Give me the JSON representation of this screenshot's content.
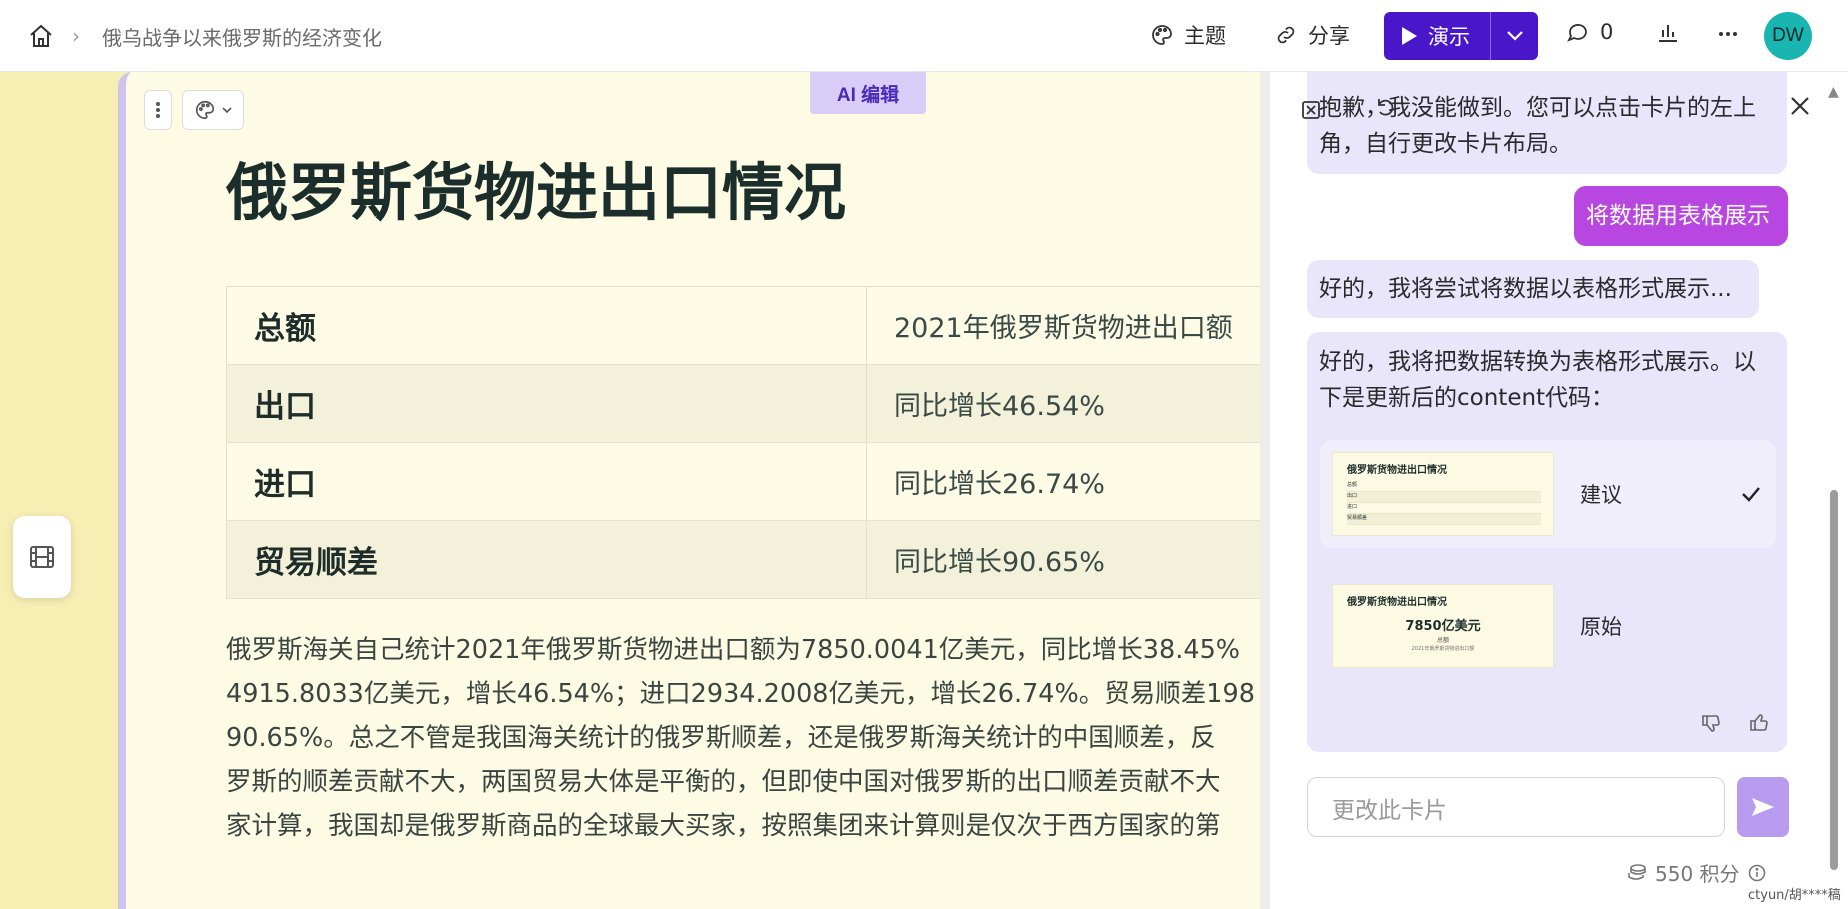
{
  "header": {
    "doc_title": "俄乌战争以来俄罗斯的经济变化",
    "theme_label": "主题",
    "share_label": "分享",
    "present_label": "演示",
    "comments_count": "0",
    "avatar_initials": "DW"
  },
  "card": {
    "ai_edit_label": "AI 编辑",
    "title": "俄罗斯货物进出口情况",
    "table": [
      {
        "key": "总额",
        "value": "2021年俄罗斯货物进出口额"
      },
      {
        "key": "出口",
        "value": "同比增长46.54%"
      },
      {
        "key": "进口",
        "value": "同比增长26.74%"
      },
      {
        "key": "贸易顺差",
        "value": "同比增长90.65%"
      }
    ],
    "paragraph_lines": [
      "俄罗斯海关自己统计2021年俄罗斯货物进出口额为7850.0041亿美元，同比增长38.45%",
      "4915.8033亿美元，增长46.54%；进口2934.2008亿美元，增长26.74%。贸易顺差198",
      "90.65%。总之不管是我国海关统计的俄罗斯顺差，还是俄罗斯海关统计的中国顺差，反",
      "罗斯的顺差贡献不大，两国贸易大体是平衡的，但即使中国对俄罗斯的出口顺差贡献不大",
      "家计算，我国却是俄罗斯商品的全球最大买家，按照集团来计算则是仅次于西方国家的第"
    ]
  },
  "chat": {
    "msg1_line1": "抱歉，我没能做到。您可以点击卡片的左上",
    "msg1_line2": "角，自行更改卡片布局。",
    "user_msg": "将数据用表格展示",
    "msg2": "好的，我将尝试将数据以表格形式展示...",
    "msg3_line1": "好的，我将把数据转换为表格形式展示。以",
    "msg3_line2": "下是更新后的content代码：",
    "option_suggest": "建议",
    "option_original": "原始",
    "thumb_title": "俄罗斯货物进出口情况",
    "thumb_rows": [
      "总额",
      "出口",
      "进口",
      "贸易顺差"
    ],
    "thumb_big": "7850亿美元",
    "thumb_sub": "总额",
    "thumb_sub2": "2021年俄罗斯货物进出口额",
    "input_placeholder": "更改此卡片",
    "credits": "550 积分"
  },
  "watermark": "ctyun/胡****稿",
  "colors": {
    "accent": "#4a16c9",
    "user_bubble": "#b846e0",
    "ai_bubble": "#e9e5fb",
    "card_bg": "#fdfbe3",
    "avatar_bg": "#19b5b0"
  }
}
